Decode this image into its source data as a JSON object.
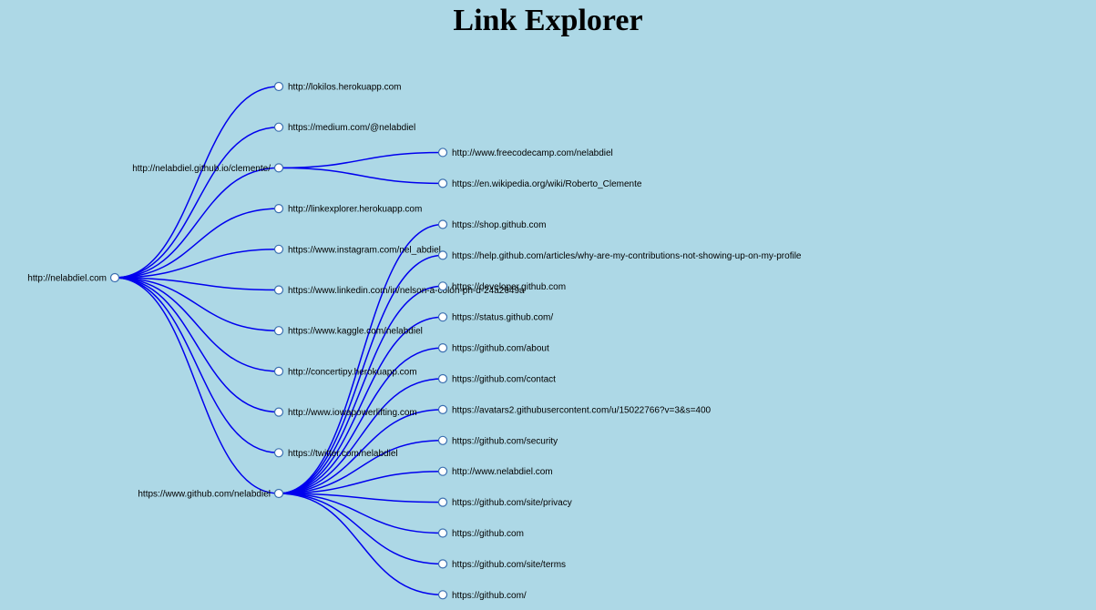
{
  "title": "Link Explorer",
  "colors": {
    "background": "#add8e6",
    "link": "#0000ee",
    "node_fill": "#ffffff"
  },
  "tree": {
    "name": "http://nelabdiel.com",
    "children": [
      {
        "name": "http://lokilos.herokuapp.com"
      },
      {
        "name": "https://medium.com/@nelabdiel"
      },
      {
        "name": "http://nelabdiel.github.io/clemente/",
        "children": [
          {
            "name": "http://www.freecodecamp.com/nelabdiel"
          },
          {
            "name": "https://en.wikipedia.org/wiki/Roberto_Clemente"
          }
        ]
      },
      {
        "name": "http://linkexplorer.herokuapp.com"
      },
      {
        "name": "https://www.instagram.com/nel_abdiel"
      },
      {
        "name": "https://www.linkedin.com/in/nelson-a-colón-ph-d-24a2649a"
      },
      {
        "name": "https://www.kaggle.com/nelabdiel"
      },
      {
        "name": "http://concertipy.herokuapp.com"
      },
      {
        "name": "http://www.iowapowerlifting.com"
      },
      {
        "name": "https://twitter.com/nelabdiel"
      },
      {
        "name": "https://www.github.com/nelabdiel",
        "children": [
          {
            "name": "https://shop.github.com"
          },
          {
            "name": "https://help.github.com/articles/why-are-my-contributions-not-showing-up-on-my-profile"
          },
          {
            "name": "https://developer.github.com"
          },
          {
            "name": "https://status.github.com/"
          },
          {
            "name": "https://github.com/about"
          },
          {
            "name": "https://github.com/contact"
          },
          {
            "name": "https://avatars2.githubusercontent.com/u/15022766?v=3&s=400"
          },
          {
            "name": "https://github.com/security"
          },
          {
            "name": "http://www.nelabdiel.com"
          },
          {
            "name": "https://github.com/site/privacy"
          },
          {
            "name": "https://github.com"
          },
          {
            "name": "https://github.com/site/terms"
          },
          {
            "name": "https://github.com/"
          }
        ]
      }
    ]
  }
}
